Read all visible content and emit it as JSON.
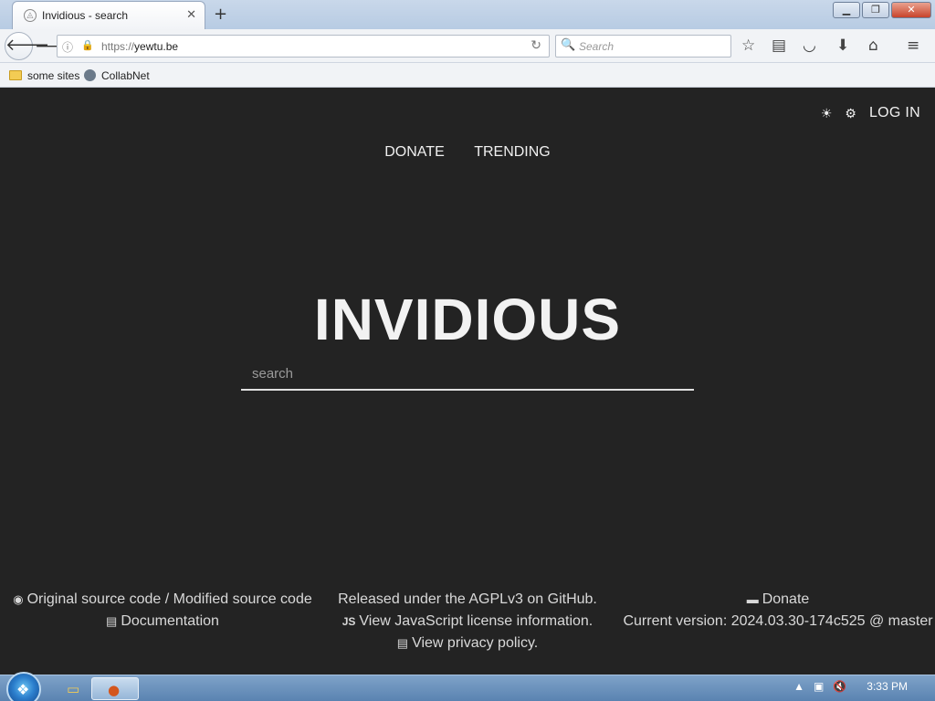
{
  "browser": {
    "tab": {
      "title": "Invidious - search",
      "favicon": "invidious-icon"
    },
    "url": {
      "scheme": "https://",
      "host": "yewtu.be"
    },
    "search_placeholder": "Search",
    "bookmarks": [
      {
        "label": "some sites",
        "icon": "folder-icon"
      },
      {
        "label": "CollabNet",
        "icon": "globe-icon"
      }
    ]
  },
  "page": {
    "top_right": {
      "theme_icon": "sun-icon",
      "settings_icon": "gear-icon",
      "login": "LOG IN"
    },
    "nav": {
      "donate": "DONATE",
      "trending": "TRENDING"
    },
    "logo": "INVIDIOUS",
    "search": {
      "placeholder": "search"
    },
    "footer": {
      "source": "Original source code / Modified source code",
      "documentation": "Documentation",
      "license": "Released under the AGPLv3 on GitHub.",
      "js_badge": "JS",
      "js_license": "View JavaScript license information.",
      "privacy": "View privacy policy.",
      "donate": "Donate",
      "version": "Current version: 2024.03.30-174c525 @ master"
    }
  },
  "taskbar": {
    "clock": "3:33 PM"
  },
  "colors": {
    "page_bg": "#232323",
    "text": "#f0f0f0",
    "taskbar": "#5a83b1"
  }
}
